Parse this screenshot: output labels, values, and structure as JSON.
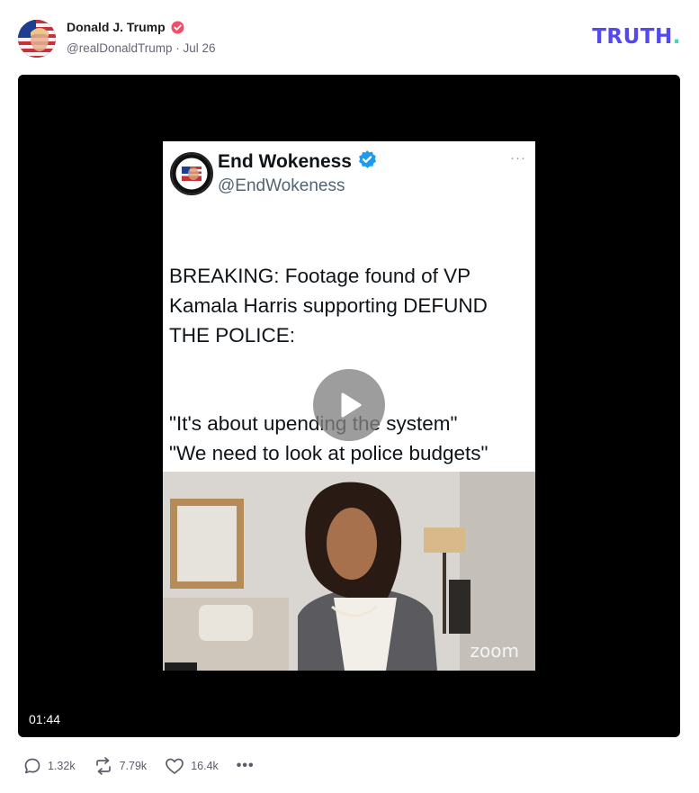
{
  "post": {
    "author_name": "Donald J. Trump",
    "handle": "@realDonaldTrump",
    "separator": "·",
    "date": "Jul 26"
  },
  "brand": {
    "logo_text": "TRUTH",
    "logo_dot": ".",
    "color_primary": "#5448ee",
    "color_accent": "#33dcc0"
  },
  "video": {
    "duration": "01:44",
    "embedded_post": {
      "name": "End Wokeness",
      "handle": "@EndWokeness",
      "more": "···",
      "paragraphs": [
        "BREAKING: Footage found of VP Kamala Harris supporting DEFUND THE POLICE:",
        "\"It's about upending the system\"\n\"We need to look at police budgets\"\n\"More safety with more cops is wrong\""
      ]
    },
    "clip_watermark": "zoom"
  },
  "actions": {
    "replies": "1.32k",
    "retruths": "7.79k",
    "likes": "16.4k",
    "more": "•••"
  },
  "icons": [
    "avatar",
    "verified-badge-icon",
    "play-icon",
    "reply-icon",
    "retruth-icon",
    "like-icon",
    "more-icon"
  ]
}
